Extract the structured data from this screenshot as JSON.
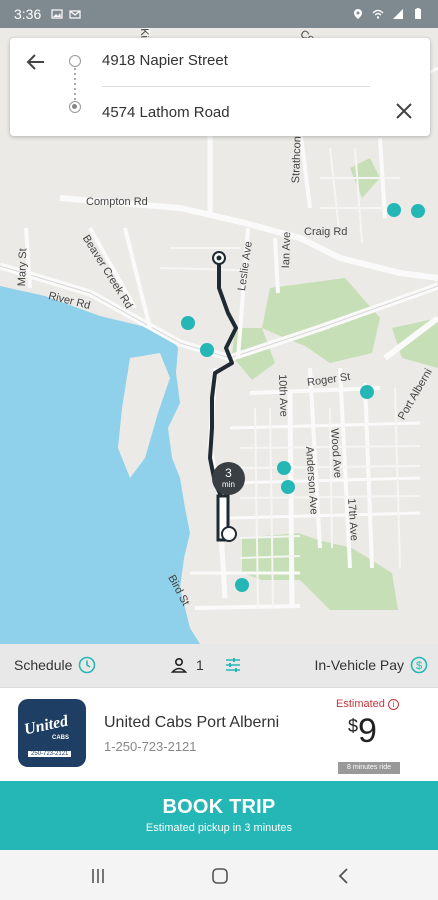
{
  "status_bar": {
    "time": "3:36"
  },
  "route": {
    "origin": "4918 Napier Street",
    "destination": "4574 Lathom Road"
  },
  "map": {
    "streets": [
      "Compton Rd",
      "Craig Rd",
      "Beaver Creek Rd",
      "Mary St",
      "River Rd",
      "Leslie Ave",
      "Ian Ave",
      "Strathcona",
      "10th Ave",
      "Roger St",
      "Anderson Ave",
      "Wood Ave",
      "17th Ave",
      "Port Alberni",
      "Bird St",
      "Cowley Rd",
      "Kitsu"
    ],
    "eta_badge": {
      "number": "3",
      "unit": "min"
    }
  },
  "options": {
    "schedule_label": "Schedule",
    "passenger_count": "1",
    "payment_label": "In-Vehicle Pay"
  },
  "provider": {
    "logo_text": "United",
    "logo_subtext": "CABS",
    "logo_phone": "250-723-2121",
    "name": "United Cabs Port Alberni",
    "phone": "1-250-723-2121",
    "estimated_label": "Estimated",
    "currency": "$",
    "price": "9",
    "ride_time": "8 minutes ride"
  },
  "book": {
    "label": "BOOK TRIP",
    "sub": "Estimated pickup in 3 minutes"
  },
  "colors": {
    "accent": "#25b7b5",
    "route": "#1f2a33",
    "error": "#c8343e",
    "logo_bg": "#1f3e63"
  }
}
